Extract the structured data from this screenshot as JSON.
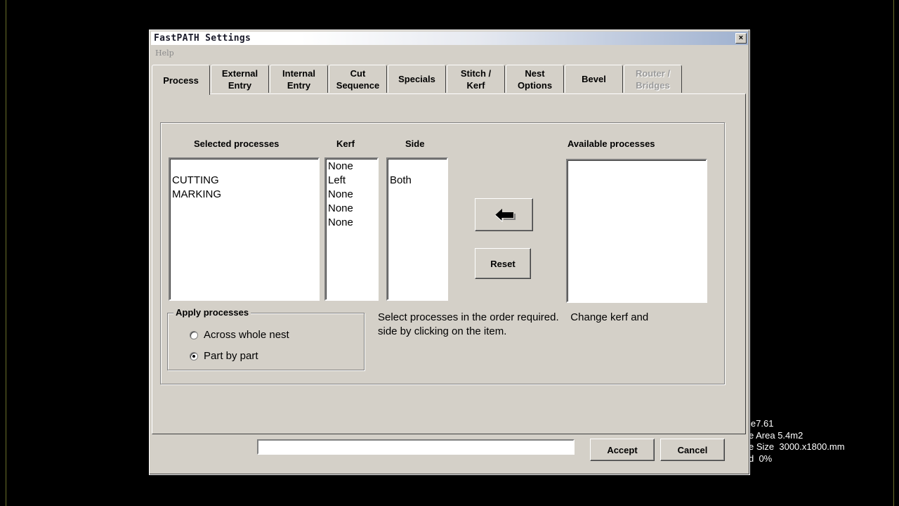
{
  "dialog": {
    "title": "FastPATH Settings",
    "close_glyph": "×",
    "menu": {
      "help": "Help"
    }
  },
  "tabs": [
    {
      "label": "Process",
      "active": true,
      "enabled": true
    },
    {
      "label": "External\nEntry",
      "enabled": true
    },
    {
      "label": "Internal\nEntry",
      "enabled": true
    },
    {
      "label": "Cut\nSequence",
      "enabled": true
    },
    {
      "label": "Specials",
      "enabled": true
    },
    {
      "label": "Stitch /\nKerf",
      "enabled": true
    },
    {
      "label": "Nest\nOptions",
      "enabled": true
    },
    {
      "label": "Bevel",
      "enabled": true
    },
    {
      "label": "Router /\nBridges",
      "enabled": false
    }
  ],
  "process_tab": {
    "headers": {
      "selected": "Selected processes",
      "kerf": "Kerf",
      "side": "Side",
      "available": "Available processes"
    },
    "selected_processes": [
      "",
      "CUTTING",
      "MARKING"
    ],
    "kerf_values": [
      "None",
      "Left",
      "None",
      "None",
      "None"
    ],
    "side_values": [
      "",
      "Both"
    ],
    "available_processes": [],
    "move_button_icon": "arrow-left-icon",
    "reset_button": "Reset",
    "apply_group": {
      "legend": "Apply processes",
      "options": [
        {
          "label": "Across whole nest",
          "checked": false
        },
        {
          "label": "Part by part",
          "checked": true
        }
      ]
    },
    "hint_line1": "Select processes in the order required.    Change kerf and",
    "hint_line2": "side by clicking on the item."
  },
  "footer": {
    "status_value": "",
    "accept": "Accept",
    "cancel": "Cancel"
  },
  "background_status": {
    "line1": "le7.61",
    "line2": "e Area 5.4m2",
    "line3": "e Size  3000.x1800.mm",
    "line4": "d  0%"
  }
}
